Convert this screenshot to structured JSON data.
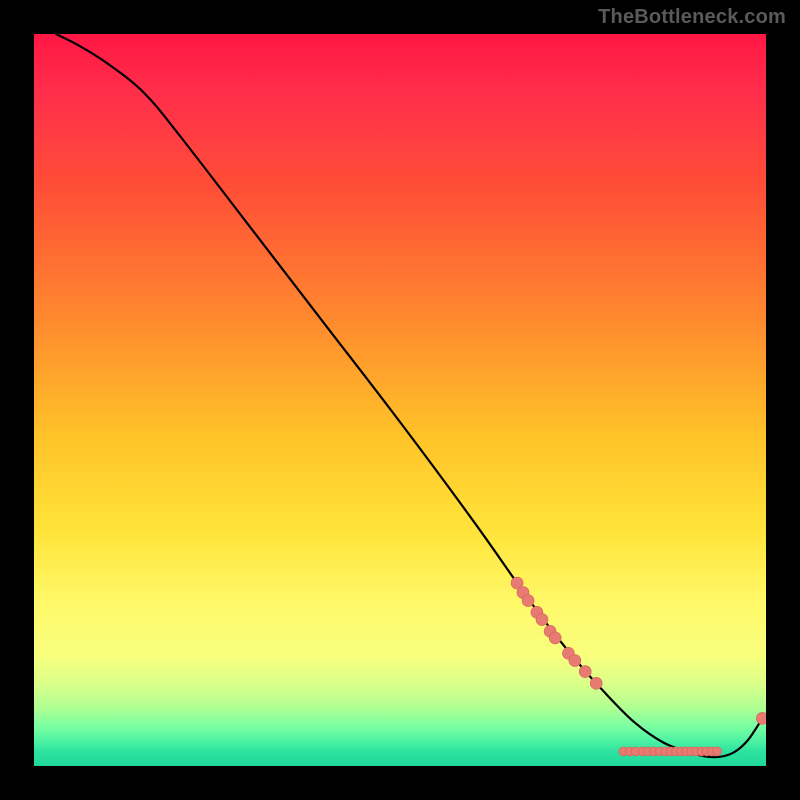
{
  "watermark": "TheBottleneck.com",
  "colors": {
    "background": "#000000",
    "curve": "#000000",
    "point_fill": "#e77a71",
    "point_stroke": "#d85f5c"
  },
  "chart_data": {
    "type": "line",
    "title": "",
    "xlabel": "",
    "ylabel": "",
    "xlim": [
      0,
      100
    ],
    "ylim": [
      0,
      100
    ],
    "series": [
      {
        "name": "curve",
        "x": [
          3,
          6,
          10,
          15,
          20,
          30,
          40,
          50,
          60,
          66,
          70,
          74,
          78,
          82,
          86,
          90,
          93,
          95.5,
          97.5,
          99.5
        ],
        "y": [
          100,
          98.5,
          96,
          92,
          86,
          73,
          60,
          47,
          33.5,
          25,
          19.5,
          14.5,
          10,
          6,
          3.2,
          1.7,
          1.2,
          1.8,
          3.5,
          6.5
        ]
      }
    ],
    "points": [
      {
        "x": 66.0,
        "y": 25.0
      },
      {
        "x": 66.8,
        "y": 23.7
      },
      {
        "x": 67.5,
        "y": 22.6
      },
      {
        "x": 68.7,
        "y": 21.0
      },
      {
        "x": 69.4,
        "y": 20.0
      },
      {
        "x": 70.5,
        "y": 18.4
      },
      {
        "x": 71.2,
        "y": 17.5
      },
      {
        "x": 73.0,
        "y": 15.4
      },
      {
        "x": 73.9,
        "y": 14.4
      },
      {
        "x": 75.3,
        "y": 12.9
      },
      {
        "x": 76.8,
        "y": 11.3
      },
      {
        "x": 80.5,
        "y": 2.0
      },
      {
        "x": 81.4,
        "y": 2.0
      },
      {
        "x": 82.2,
        "y": 2.0
      },
      {
        "x": 83.1,
        "y": 2.0
      },
      {
        "x": 83.9,
        "y": 2.0
      },
      {
        "x": 84.7,
        "y": 2.0
      },
      {
        "x": 85.5,
        "y": 2.0
      },
      {
        "x": 86.3,
        "y": 2.0
      },
      {
        "x": 87.0,
        "y": 2.0
      },
      {
        "x": 87.7,
        "y": 2.0
      },
      {
        "x": 88.4,
        "y": 2.0
      },
      {
        "x": 89.1,
        "y": 2.0
      },
      {
        "x": 89.8,
        "y": 2.0
      },
      {
        "x": 90.5,
        "y": 2.0
      },
      {
        "x": 91.2,
        "y": 2.0
      },
      {
        "x": 91.9,
        "y": 2.0
      },
      {
        "x": 92.6,
        "y": 2.0
      },
      {
        "x": 93.3,
        "y": 2.0
      },
      {
        "x": 99.5,
        "y": 6.5
      }
    ],
    "point_radius_large": 6,
    "point_radius_small": 4.5
  }
}
